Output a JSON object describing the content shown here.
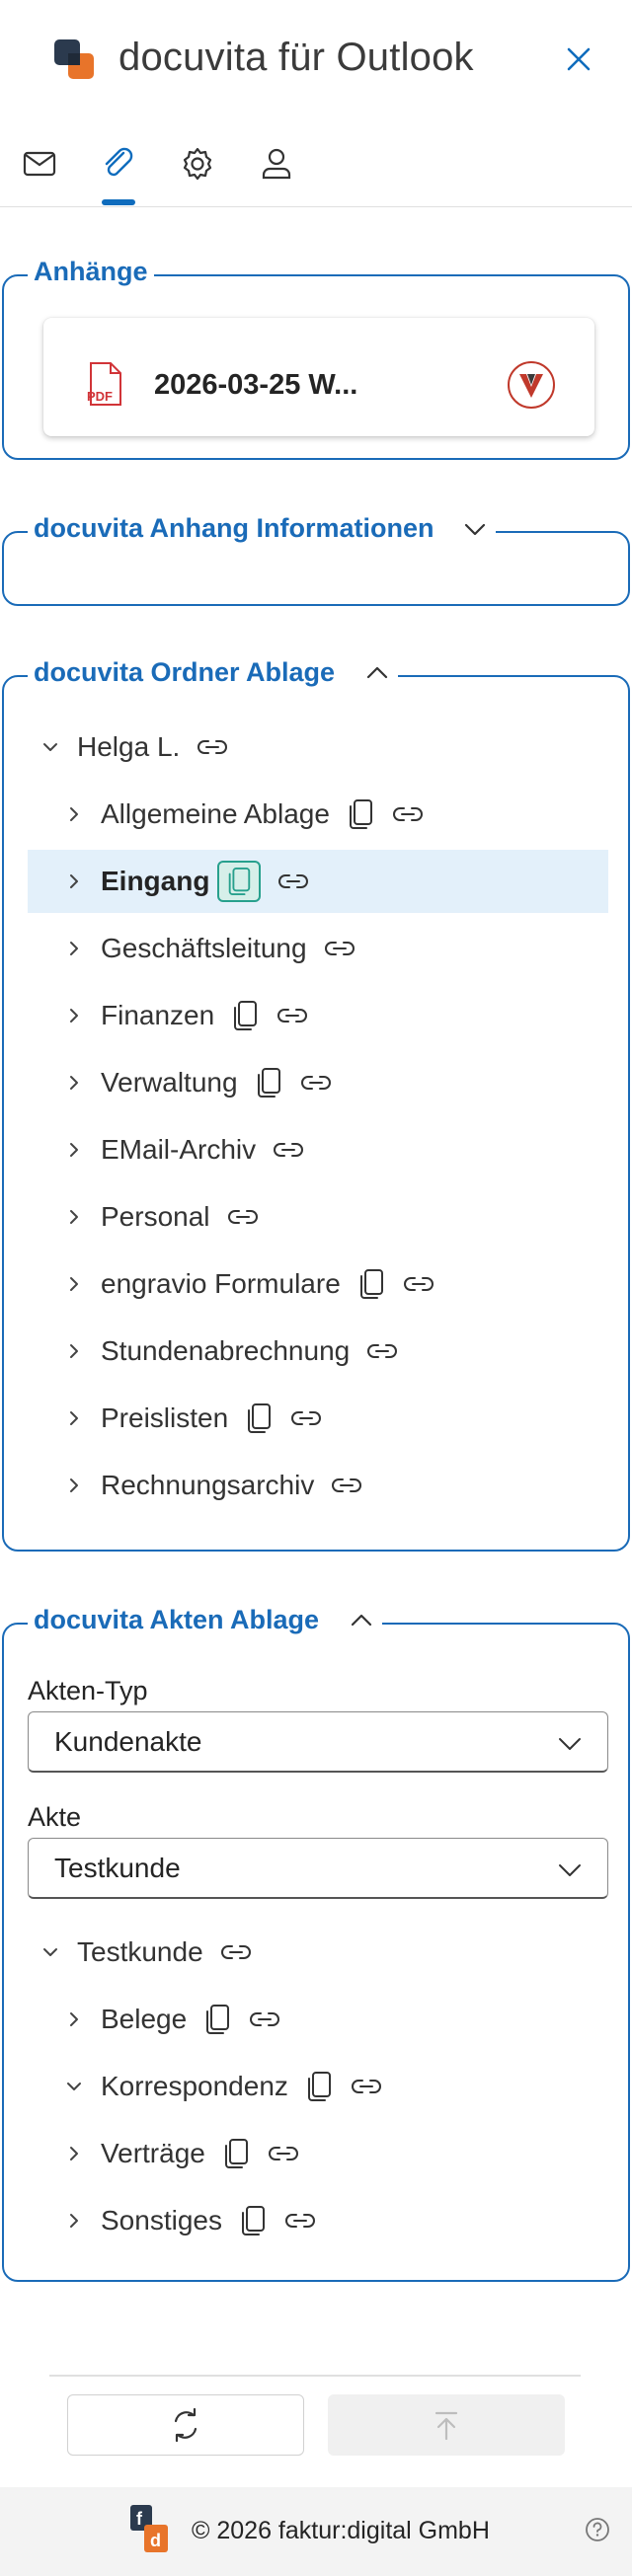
{
  "header": {
    "title": "docuvita für Outlook"
  },
  "tabs": [
    {
      "name": "mail",
      "icon": "mail-icon"
    },
    {
      "name": "attachments",
      "icon": "paperclip-icon",
      "active": true
    },
    {
      "name": "settings",
      "icon": "gear-icon"
    },
    {
      "name": "user",
      "icon": "user-icon"
    }
  ],
  "attachments": {
    "legend": "Anhänge",
    "items": [
      {
        "icon": "pdf-icon",
        "type_label": "PDF",
        "name": "2026-03-25 W...",
        "status_icon": "docuvita-icon"
      }
    ]
  },
  "info_section": {
    "legend": "docuvita Anhang Informationen",
    "expanded": false
  },
  "folder_section": {
    "legend": "docuvita Ordner Ablage",
    "expanded": true,
    "root": {
      "label": "Helga L."
    },
    "items": [
      {
        "label": "Allgemeine Ablage",
        "copy": true
      },
      {
        "label": "Eingang",
        "copy": true,
        "selected": true
      },
      {
        "label": "Geschäftsleitung",
        "copy": false
      },
      {
        "label": "Finanzen",
        "copy": true
      },
      {
        "label": "Verwaltung",
        "copy": true
      },
      {
        "label": "EMail-Archiv",
        "copy": false
      },
      {
        "label": "Personal",
        "copy": false
      },
      {
        "label": "engravio Formulare",
        "copy": true
      },
      {
        "label": "Stundenabrechnung",
        "copy": false
      },
      {
        "label": "Preislisten",
        "copy": true
      },
      {
        "label": "Rechnungsarchiv",
        "copy": false
      }
    ]
  },
  "akten_section": {
    "legend": "docuvita Akten Ablage",
    "expanded": true,
    "akten_typ_label": "Akten-Typ",
    "akten_typ_value": "Kundenakte",
    "akte_label": "Akte",
    "akte_value": "Testkunde",
    "root": {
      "label": "Testkunde"
    },
    "items": [
      {
        "label": "Belege",
        "expanded": false
      },
      {
        "label": "Korrespondenz",
        "expanded": true
      },
      {
        "label": "Verträge",
        "expanded": false
      },
      {
        "label": "Sonstiges",
        "expanded": false
      }
    ]
  },
  "footer": {
    "text": "© 2026 faktur:digital GmbH"
  },
  "colors": {
    "accent": "#1a6bb8",
    "selected_bg": "#e3f0fa",
    "highlight": "#27a08d"
  }
}
